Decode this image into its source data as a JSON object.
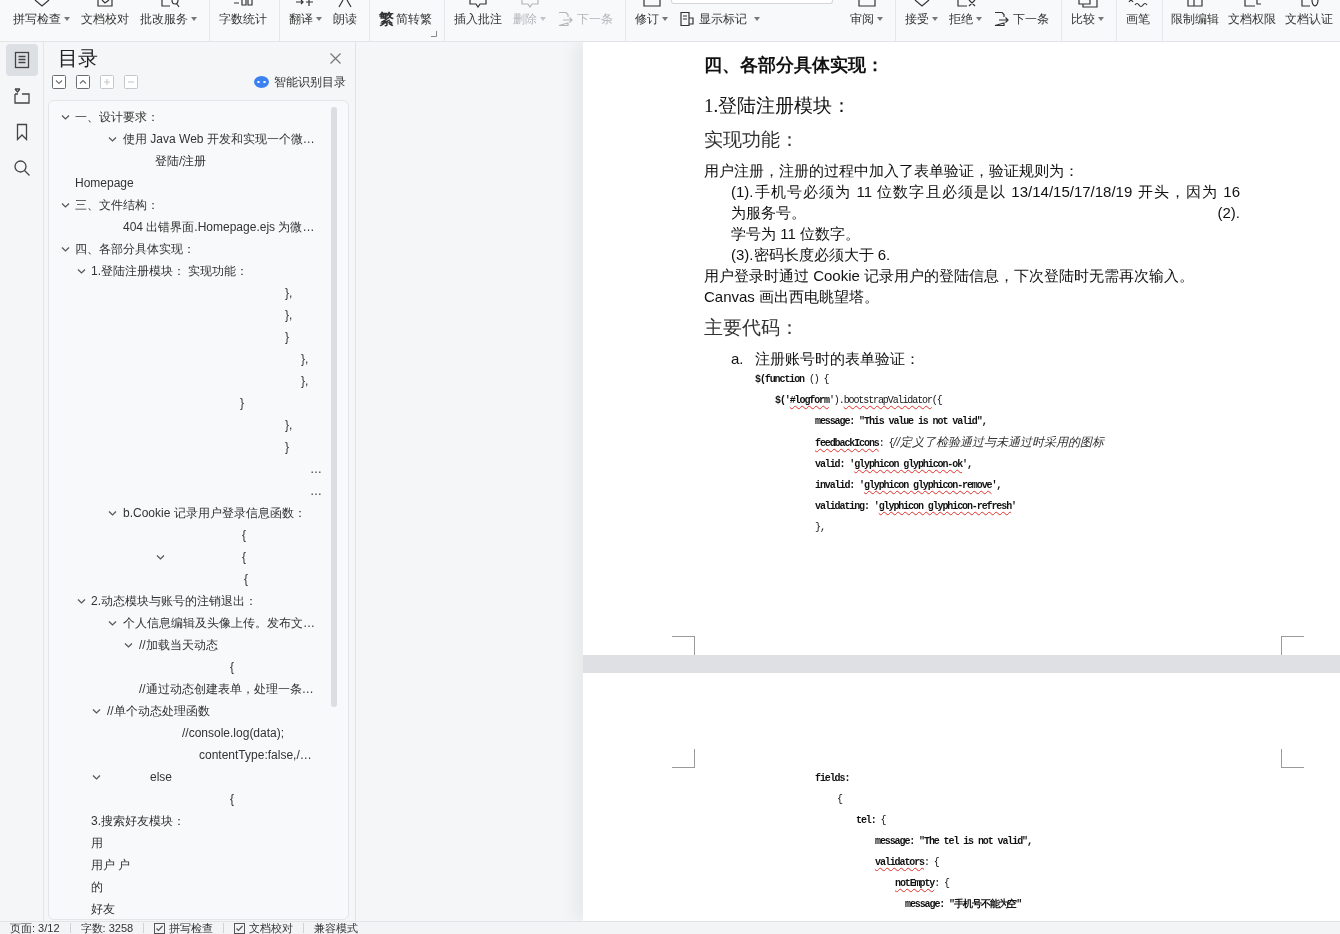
{
  "toolbar": {
    "groups": [
      {
        "items": [
          {
            "label": "拼写检查",
            "kind": "large",
            "dropdown": true,
            "disabled": false
          },
          {
            "label": "文档校对",
            "kind": "large",
            "disabled": false
          },
          {
            "label": "批改服务",
            "kind": "large",
            "dropdown": true,
            "disabled": false
          }
        ]
      },
      {
        "items": [
          {
            "label": "字数统计",
            "kind": "large",
            "disabled": false
          }
        ]
      },
      {
        "items": [
          {
            "label": "翻译",
            "kind": "large",
            "dropdown": true,
            "disabled": false
          },
          {
            "label": "朗读",
            "kind": "large",
            "disabled": false
          }
        ]
      },
      {
        "launcher": true,
        "items": [
          {
            "label": "简转繁",
            "kind": "glyph",
            "glyph": "繁",
            "disabled": false
          }
        ]
      },
      {
        "items": [
          {
            "label": "插入批注",
            "kind": "large",
            "disabled": false
          },
          {
            "label": "删除",
            "kind": "large",
            "dropdown": true,
            "disabled": true
          },
          {
            "label": "下一条",
            "kind": "small",
            "disabled": true
          }
        ]
      },
      {
        "items": [
          {
            "label": "修订",
            "kind": "large",
            "dropdown": true,
            "disabled": false
          },
          {
            "label": "显示标记",
            "kind": "small-field",
            "dropdown": true,
            "disabled": false
          },
          {
            "label": "审阅",
            "kind": "large",
            "dropdown": true,
            "disabled": false
          }
        ]
      },
      {
        "items": [
          {
            "label": "接受",
            "kind": "large",
            "dropdown": true,
            "disabled": false
          },
          {
            "label": "拒绝",
            "kind": "large",
            "dropdown": true,
            "disabled": false
          },
          {
            "label": "下一条",
            "kind": "small",
            "disabled": false
          }
        ]
      },
      {
        "items": [
          {
            "label": "比较",
            "kind": "large",
            "dropdown": true,
            "disabled": false
          }
        ]
      },
      {
        "items": [
          {
            "label": "画笔",
            "kind": "large",
            "disabled": false
          }
        ]
      },
      {
        "items": [
          {
            "label": "限制编辑",
            "kind": "large",
            "disabled": false
          },
          {
            "label": "文档权限",
            "kind": "large",
            "disabled": false
          },
          {
            "label": "文档认证",
            "kind": "large",
            "disabled": false
          }
        ]
      }
    ]
  },
  "sidebar": {
    "rail": [
      {
        "selected": true
      },
      {
        "selected": false
      },
      {
        "selected": false
      },
      {
        "selected": false
      }
    ],
    "title": "目录",
    "outline_tools": [
      {
        "disabled": false
      },
      {
        "disabled": false
      },
      {
        "disabled": true
      },
      {
        "disabled": true
      }
    ],
    "smart_toc": "智能识别目录",
    "toc": [
      {
        "text": "一、设计要求：",
        "expanded": true,
        "children": [
          {
            "text": "使用 Java Web 开发和实现一个微…",
            "expanded": true,
            "children": [
              {
                "text": "登陆/注册"
              }
            ]
          }
        ]
      },
      {
        "text": "Homepage"
      },
      {
        "text": "三、文件结构：",
        "expanded": true,
        "children": [
          {
            "text": "404 出错界面.Homepage.ejs 为微…"
          }
        ]
      },
      {
        "text": "四、各部分具体实现：",
        "expanded": true,
        "children": [
          {
            "text": "1.登陆注册模块： 实现功能：",
            "expanded": true,
            "children": [
              {
                "text": "},"
              },
              {
                "text": "},"
              },
              {
                "text": "}"
              },
              {
                "text": "},"
              },
              {
                "text": "},"
              },
              {
                "text": "}"
              },
              {
                "text": "},"
              },
              {
                "text": "}"
              },
              {
                "text": "…"
              },
              {
                "text": "…"
              },
              {
                "text": "b.Cookie 记录用户登录信息函数：",
                "expanded": true,
                "children": [
                  {
                    "text": "{"
                  },
                  {
                    "text": "{",
                    "expanded": true,
                    "children": [
                      {
                        "text": "{"
                      }
                    ]
                  }
                ]
              }
            ]
          },
          {
            "text": "2.动态模块与账号的注销退出：",
            "expanded": true,
            "children": [
              {
                "text": "个人信息编辑及头像上传。发布文…",
                "expanded": true,
                "children": [
                  {
                    "text": "//加载当天动态",
                    "expanded": true,
                    "children": [
                      {
                        "text": "{"
                      },
                      {
                        "text": "//通过动态创建表单，处理一条…"
                      }
                    ]
                  }
                ]
              },
              {
                "text": "//单个动态处理函数",
                "expanded": true,
                "children": [
                  {
                    "text": "//console.log(data);"
                  },
                  {
                    "text": "contentType:false,/…"
                  }
                ]
              },
              {
                "text": "else",
                "expanded": true,
                "children": [
                  {
                    "text": "{"
                  }
                ]
              }
            ]
          },
          {
            "text": "3.搜索好友模块："
          },
          {
            "text": "用"
          },
          {
            "text": "用户 户"
          },
          {
            "text": "的"
          },
          {
            "text": "好友"
          }
        ]
      }
    ]
  },
  "document": {
    "pages": [
      {
        "blocks": [
          {
            "kind": "heading1",
            "text": "四、各部分具体实现："
          },
          {
            "kind": "heading2",
            "text": "1.登陆注册模块："
          },
          {
            "kind": "heading3",
            "text": "实现功能："
          },
          {
            "kind": "paragraph",
            "text": "用户注册，注册的过程中加入了表单验证，验证规则为："
          },
          {
            "kind": "indented-justified",
            "text": "(1).手机号必须为 11 位数字且必须是以 13/14/15/17/18/19 开头，因为 16"
          },
          {
            "kind": "indented-split",
            "text": "为服务号。",
            "right": "(2)."
          },
          {
            "kind": "indented",
            "text": "学号为 11 位数字。"
          },
          {
            "kind": "indented",
            "text": "(3).密码长度必须大于 6."
          },
          {
            "kind": "paragraph",
            "text": "用户登录时通过 Cookie 记录用户的登陆信息，下次登陆时无需再次输入。"
          },
          {
            "kind": "paragraph",
            "text": "Canvas 画出西电眺望塔。"
          },
          {
            "kind": "heading3",
            "text": "主要代码："
          },
          {
            "kind": "list-item",
            "marker": "a.",
            "text": "注册账号时的表单验证："
          },
          {
            "kind": "code",
            "lines": [
              {
                "parts": [
                  {
                    "text": "$(function",
                    "kind": "strong"
                  },
                  {
                    "text": " () {",
                    "kind": "normal"
                  }
                ],
                "children": [
                  {
                    "parts": [
                      {
                        "text": "$('",
                        "kind": "strong"
                      },
                      {
                        "text": "#logform",
                        "kind": "strong-misspelled"
                      },
                      {
                        "text": "').",
                        "kind": "normal"
                      },
                      {
                        "text": "bootstrapValidator",
                        "kind": "normal-misspelled"
                      },
                      {
                        "text": "({",
                        "kind": "normal"
                      }
                    ],
                    "children": [
                      {
                        "parts": [
                          {
                            "text": "message: \"This value is not valid\",",
                            "kind": "strong"
                          }
                        ]
                      },
                      {
                        "parts": [
                          {
                            "text": "feedbackIcons",
                            "kind": "strong-misspelled"
                          },
                          {
                            "text": ": {",
                            "kind": "normal"
                          },
                          {
                            "text": "//定义了检验通过与未通过时采用的图标",
                            "kind": "comment"
                          }
                        ]
                      },
                      {
                        "parts": [
                          {
                            "text": "valid: '",
                            "kind": "strong"
                          },
                          {
                            "text": "glyphicon glyphicon-ok",
                            "kind": "strong-misspelled"
                          },
                          {
                            "text": "',",
                            "kind": "strong"
                          }
                        ]
                      },
                      {
                        "parts": [
                          {
                            "text": "invalid: '",
                            "kind": "strong"
                          },
                          {
                            "text": "glyphicon glyphicon-remove",
                            "kind": "strong-misspelled"
                          },
                          {
                            "text": "',",
                            "kind": "strong"
                          }
                        ]
                      },
                      {
                        "parts": [
                          {
                            "text": "validating: '",
                            "kind": "strong"
                          },
                          {
                            "text": "glyphicon glyphicon-refresh",
                            "kind": "strong-misspelled"
                          },
                          {
                            "text": "'",
                            "kind": "strong"
                          }
                        ]
                      },
                      {
                        "parts": [
                          {
                            "text": "},",
                            "kind": "normal"
                          }
                        ]
                      }
                    ]
                  }
                ]
              }
            ]
          }
        ]
      },
      {
        "blocks": [
          {
            "kind": "code",
            "lines": [
              {
                "parts": [
                  {
                    "text": "fields:",
                    "kind": "strong"
                  }
                ],
                "children": [
                  {
                    "parts": [
                      {
                        "text": "{",
                        "kind": "normal"
                      }
                    ],
                    "children": [
                      {
                        "parts": [
                          {
                            "text": "tel:",
                            "kind": "strong"
                          },
                          {
                            "text": " {",
                            "kind": "normal"
                          }
                        ],
                        "children": [
                          {
                            "parts": [
                              {
                                "text": "message: \"The tel is not valid\",",
                                "kind": "strong"
                              }
                            ]
                          },
                          {
                            "parts": [
                              {
                                "text": "validators",
                                "kind": "strong-misspelled"
                              },
                              {
                                "text": ": {",
                                "kind": "normal"
                              }
                            ],
                            "children": [
                              {
                                "parts": [
                                  {
                                    "text": "notEmpty",
                                    "kind": "strong-misspelled"
                                  },
                                  {
                                    "text": ": {",
                                    "kind": "normal"
                                  }
                                ],
                                "children": [
                                  {
                                    "parts": [
                                      {
                                        "text": "message: \"手机号不能为空\"",
                                        "kind": "strong"
                                      }
                                    ]
                                  }
                                ]
                              }
                            ]
                          }
                        ]
                      }
                    ]
                  }
                ]
              }
            ]
          }
        ]
      }
    ]
  },
  "status_bar": {
    "items": [
      {
        "kind": "text",
        "text": "页面: 3/12"
      },
      {
        "kind": "text",
        "text": "字数: 3258"
      },
      {
        "kind": "check",
        "text": "拼写检查"
      },
      {
        "kind": "check",
        "text": "文档校对"
      },
      {
        "kind": "text",
        "text": "兼容模式"
      }
    ]
  }
}
